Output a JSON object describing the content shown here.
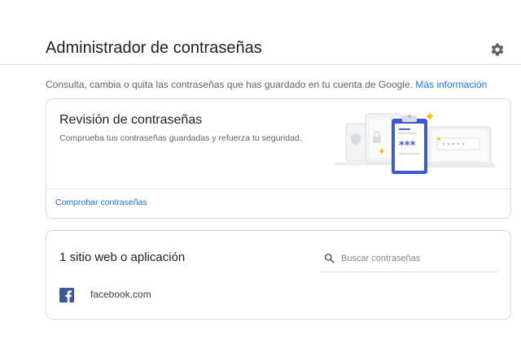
{
  "header": {
    "title": "Administrador de contraseñas",
    "settings_icon": "gear-icon"
  },
  "description": {
    "text": "Consulta, cambia o quita las contraseñas que has guardado en tu cuenta de Google.",
    "link_text": "Más información"
  },
  "review_card": {
    "title": "Revisión de contraseñas",
    "subtitle": "Comprueba tus contraseñas guardadas y refuerza tu seguridad.",
    "illustration_text": "***",
    "action_label": "Comprobar contraseñas"
  },
  "sites_card": {
    "title": "1 sitio web o aplicación",
    "search": {
      "placeholder": "Buscar contraseñas",
      "value": "",
      "icon": "search-icon"
    },
    "items": [
      {
        "name": "facebook.com",
        "icon": "facebook-icon"
      }
    ]
  },
  "colors": {
    "accent": "#1a73e8",
    "clipboard": "#3d5ad6",
    "facebook": "#3b5998",
    "sparkle": "#fbbc04"
  }
}
